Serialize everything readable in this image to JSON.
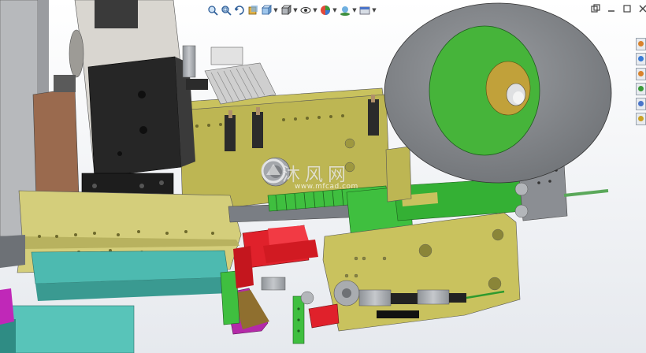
{
  "app": "SolidWorks",
  "viewport": {
    "background_top": "#ffffff",
    "background_bottom": "#e9ecef",
    "model_name": "labeling-machine-assembly"
  },
  "heads_up_toolbar": {
    "buttons": [
      {
        "name": "zoom-to-fit-icon"
      },
      {
        "name": "zoom-to-area-icon"
      },
      {
        "name": "previous-view-icon"
      },
      {
        "name": "section-view-icon"
      },
      {
        "name": "view-orientation-icon",
        "dropdown": true
      },
      {
        "name": "display-style-icon",
        "dropdown": true
      },
      {
        "name": "hide-show-items-icon",
        "dropdown": true
      },
      {
        "name": "edit-appearance-icon",
        "dropdown": true
      },
      {
        "name": "apply-scene-icon",
        "dropdown": true
      },
      {
        "name": "view-settings-icon",
        "dropdown": true
      }
    ]
  },
  "window_controls": [
    "restore-icon",
    "minimize-icon",
    "maximize-icon",
    "close-icon"
  ],
  "task_pane": {
    "tabs": [
      "resources-tab-icon",
      "design-library-tab-icon",
      "file-explorer-tab-icon",
      "view-palette-tab-icon",
      "appearances-tab-icon",
      "custom-properties-tab-icon"
    ],
    "tab_colors": [
      "#d9822b",
      "#3a7bd5",
      "#d9822b",
      "#3a9a3a",
      "#4a74c9",
      "#c9a227"
    ]
  },
  "colors": {
    "plate_olive": "#c9c25e",
    "plate_olive_dark": "#a9a346",
    "green_block": "#3fbf3f",
    "red_block": "#e0212b",
    "cyan_block": "#4dbab0",
    "magenta_block": "#c028b8",
    "steel_gray": "#a6a9ad",
    "black_part": "#1a1a1a",
    "disc_gray": "#8c8f94",
    "disc_green": "#46b43a"
  },
  "watermark": {
    "chinese_text": "沐风网",
    "url_text": "www.mfcad.com"
  }
}
